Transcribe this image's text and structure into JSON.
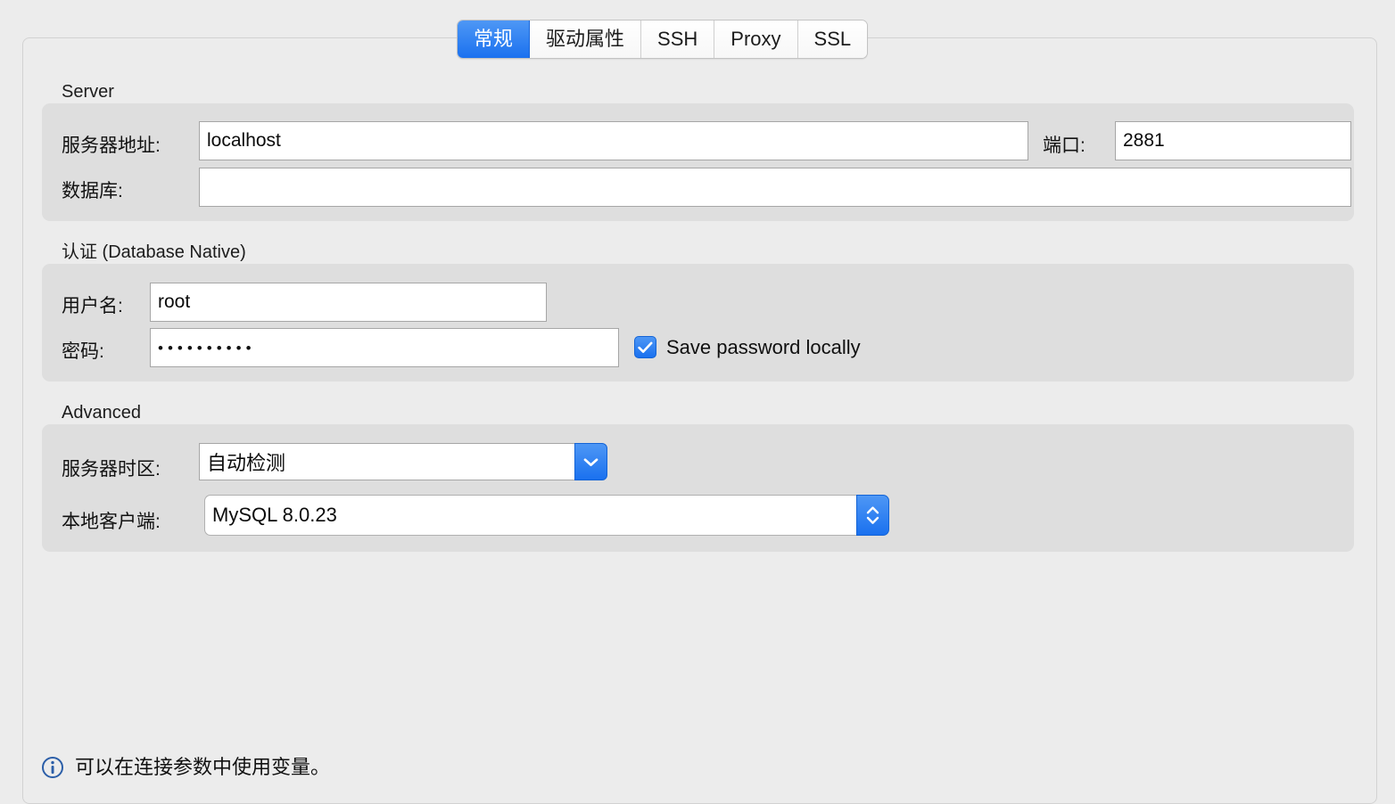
{
  "tabs": [
    {
      "label": "常规",
      "active": true,
      "name": "tab-general"
    },
    {
      "label": "驱动属性",
      "active": false,
      "name": "tab-driver-properties"
    },
    {
      "label": "SSH",
      "active": false,
      "name": "tab-ssh"
    },
    {
      "label": "Proxy",
      "active": false,
      "name": "tab-proxy"
    },
    {
      "label": "SSL",
      "active": false,
      "name": "tab-ssl"
    }
  ],
  "server": {
    "group_title": "Server",
    "host_label": "服务器地址:",
    "host_value": "localhost",
    "port_label": "端口:",
    "port_value": "2881",
    "database_label": "数据库:",
    "database_value": ""
  },
  "auth": {
    "group_title": "认证 (Database Native)",
    "username_label": "用户名:",
    "username_value": "root",
    "password_label": "密码:",
    "password_value": "••••••••••",
    "save_password_label": "Save password locally",
    "save_password_checked": true
  },
  "advanced": {
    "group_title": "Advanced",
    "timezone_label": "服务器时区:",
    "timezone_value": "自动检测",
    "client_label": "本地客户端:",
    "client_value": "MySQL 8.0.23"
  },
  "footer": {
    "hint_text": "可以在连接参数中使用变量。"
  },
  "colors": {
    "accent": "#1a71ef",
    "window_bg": "#ececec",
    "group_bg": "#dedede",
    "field_bg": "#ffffff",
    "info_icon": "#2b5ea8"
  }
}
